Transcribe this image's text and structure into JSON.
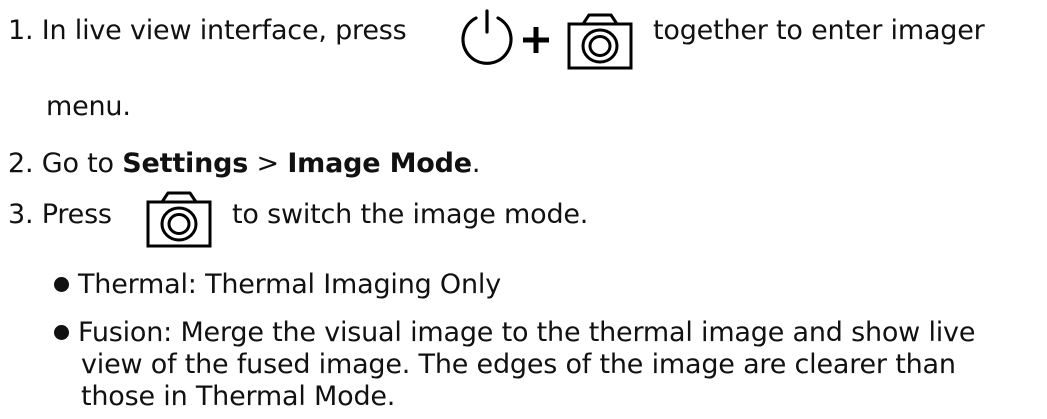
{
  "steps": {
    "step1": {
      "prefix": "1. In live view interface, press",
      "suffix": "together to enter imager",
      "continuation": "menu."
    },
    "step2": {
      "prefix": "2. Go to ",
      "settings": "Settings",
      "sep": " > ",
      "image_mode": "Image Mode",
      "end": "."
    },
    "step3": {
      "prefix": "3. Press",
      "suffix": "to switch the image mode."
    }
  },
  "bullets": [
    {
      "text": "Thermal: Thermal Imaging Only"
    },
    {
      "line1": "Fusion: Merge the visual image to the thermal image and show live",
      "line2": "view of the fused image. The edges of the image are clearer than",
      "line3": "those in Thermal Mode."
    }
  ],
  "icons": {
    "power": "power-icon",
    "plus": "plus-icon",
    "camera": "camera-icon"
  }
}
